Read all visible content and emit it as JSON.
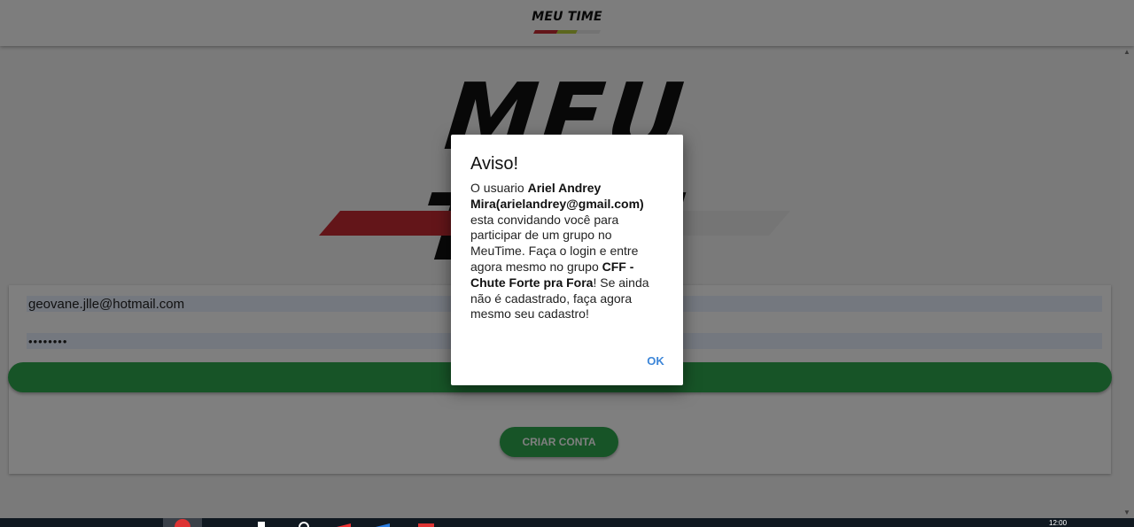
{
  "header": {
    "title": "MEU TIME"
  },
  "logo": {
    "text": "MEU TIME"
  },
  "login": {
    "email_value": "geovane.jlle@hotmail.com",
    "password_value": "••••••••",
    "create_account_label": "CRIAR CONTA"
  },
  "dialog": {
    "title": "Aviso!",
    "body": {
      "t1": "O usuario ",
      "inviter": "Ariel Andrey Mira(arielandrey@gmail.com)",
      "t2": " esta convidando você para participar de um grupo no MeuTime. Faça o login e entre agora mesmo no grupo ",
      "group": "CFF - Chute Forte pra Fora",
      "t3": "! Se ainda não é cadastrado, faça agora mesmo seu cadastro!"
    },
    "ok_label": "OK"
  },
  "taskbar": {
    "clock": "12:00"
  },
  "colors": {
    "brand_red": "#c62a33",
    "brand_green": "#2ea84f",
    "brand_lime": "#b7cc3a",
    "dialog_button_blue": "#3d86d8",
    "overlay": "rgba(0,0,0,0.5)"
  },
  "icons": [
    "chevron-up-icon",
    "chevron-down-icon",
    "chrome-icon",
    "file-icon",
    "search-icon",
    "app-icon"
  ]
}
